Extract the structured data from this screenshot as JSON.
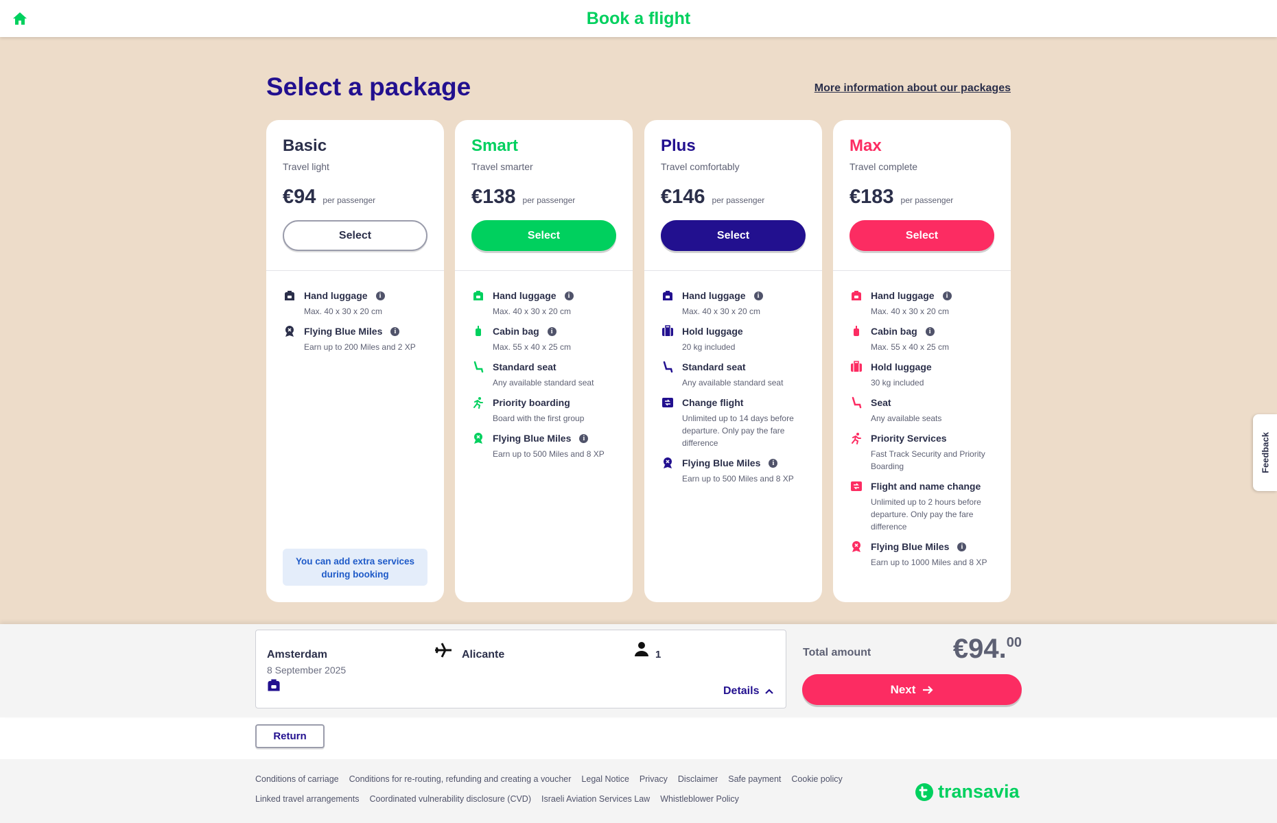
{
  "header": {
    "title": "Book a flight",
    "home_icon": "home-icon"
  },
  "page": {
    "title": "Select a package",
    "more_info_link": "More information about our packages"
  },
  "colors": {
    "green": "#00d05e",
    "indigo": "#22108f",
    "pink": "#fc2c62",
    "sand": "#eddcc9"
  },
  "packages": [
    {
      "name": "Basic",
      "subtitle": "Travel light",
      "price": "€94",
      "per": "per passenger",
      "select_label": "Select",
      "features": [
        {
          "title": "Hand luggage",
          "desc": "Max. 40 x 30 x 20 cm",
          "info": true,
          "icon": "backpack-icon"
        },
        {
          "title": "Flying Blue Miles",
          "desc": "Earn up to 200 Miles and 2 XP",
          "info": true,
          "icon": "medal-icon"
        }
      ],
      "note": "You can add extra services during booking"
    },
    {
      "name": "Smart",
      "subtitle": "Travel smarter",
      "price": "€138",
      "per": "per passenger",
      "select_label": "Select",
      "features": [
        {
          "title": "Hand luggage",
          "desc": "Max. 40 x 30 x 20 cm",
          "info": true,
          "icon": "backpack-icon"
        },
        {
          "title": "Cabin bag",
          "desc": "Max. 55 x 40 x 25 cm",
          "info": true,
          "icon": "trolley-icon"
        },
        {
          "title": "Standard seat",
          "desc": "Any available standard seat",
          "info": false,
          "icon": "seat-icon"
        },
        {
          "title": "Priority boarding",
          "desc": "Board with the first group",
          "info": false,
          "icon": "running-person-icon"
        },
        {
          "title": "Flying Blue Miles",
          "desc": "Earn up to 500 Miles and 8 XP",
          "info": true,
          "icon": "medal-icon"
        }
      ]
    },
    {
      "name": "Plus",
      "subtitle": "Travel comfortably",
      "price": "€146",
      "per": "per passenger",
      "select_label": "Select",
      "features": [
        {
          "title": "Hand luggage",
          "desc": "Max. 40 x 30 x 20 cm",
          "info": true,
          "icon": "backpack-icon"
        },
        {
          "title": "Hold luggage",
          "desc": "20 kg included",
          "info": false,
          "icon": "suitcase-icon"
        },
        {
          "title": "Standard seat",
          "desc": "Any available standard seat",
          "info": false,
          "icon": "seat-icon"
        },
        {
          "title": "Change flight",
          "desc": "Unlimited up to 14 days before departure. Only pay the fare difference",
          "info": false,
          "icon": "calendar-change-icon"
        },
        {
          "title": "Flying Blue Miles",
          "desc": "Earn up to 500 Miles and 8 XP",
          "info": true,
          "icon": "medal-icon"
        }
      ]
    },
    {
      "name": "Max",
      "subtitle": "Travel complete",
      "price": "€183",
      "per": "per passenger",
      "select_label": "Select",
      "features": [
        {
          "title": "Hand luggage",
          "desc": "Max. 40 x 30 x 20 cm",
          "info": true,
          "icon": "backpack-icon"
        },
        {
          "title": "Cabin bag",
          "desc": "Max. 55 x 40 x 25 cm",
          "info": true,
          "icon": "trolley-icon"
        },
        {
          "title": "Hold luggage",
          "desc": "30 kg included",
          "info": false,
          "icon": "suitcase-icon"
        },
        {
          "title": "Seat",
          "desc": "Any available seats",
          "info": false,
          "icon": "seat-icon"
        },
        {
          "title": "Priority Services",
          "desc": "Fast Track Security and Priority Boarding",
          "info": false,
          "icon": "running-person-icon"
        },
        {
          "title": "Flight and name change",
          "desc": "Unlimited up to 2 hours before departure. Only pay the fare difference",
          "info": false,
          "icon": "calendar-change-icon"
        },
        {
          "title": "Flying Blue Miles",
          "desc": "Earn up to 1000 Miles and 8 XP",
          "info": true,
          "icon": "medal-icon"
        }
      ]
    }
  ],
  "feedback": {
    "label": "Feedback"
  },
  "summary": {
    "from": "Amsterdam",
    "date": "8 September 2025",
    "to": "Alicante",
    "passengers": "1",
    "details_label": "Details",
    "total_label": "Total amount",
    "total_main": "€94.",
    "total_cents": "00",
    "next_label": "Next",
    "return_label": "Return"
  },
  "footer": {
    "row1": [
      "Conditions of carriage",
      "Conditions for re-routing, refunding and creating a voucher",
      "Legal Notice",
      "Privacy",
      "Disclaimer",
      "Safe payment",
      "Cookie policy"
    ],
    "row2": [
      "Linked travel arrangements",
      "Coordinated vulnerability disclosure (CVD)",
      "Israeli Aviation Services Law",
      "Whistleblower Policy"
    ],
    "brand": "transavia"
  }
}
